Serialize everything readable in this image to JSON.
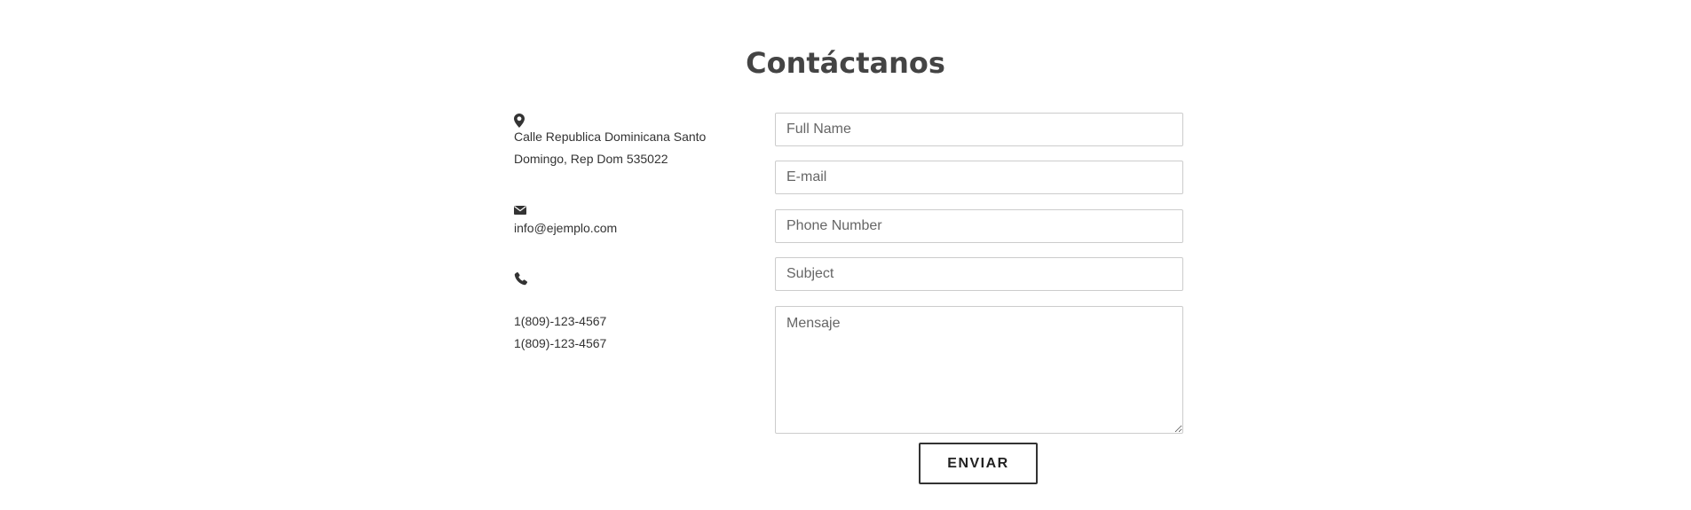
{
  "page": {
    "title": "Contáctanos"
  },
  "contact_info": {
    "address": {
      "icon": "map-marker-icon",
      "line1": "Calle Republica Dominicana Santo",
      "line2": "Domingo, Rep Dom 535022"
    },
    "email": {
      "icon": "envelope-icon",
      "value": "info@ejemplo.com"
    },
    "phone": {
      "icon": "phone-icon",
      "numbers": [
        "1(809)-123-4567",
        "1(809)-123-4567"
      ]
    }
  },
  "form": {
    "full_name": {
      "value": "",
      "placeholder": "Full Name"
    },
    "email": {
      "value": "",
      "placeholder": "E-mail"
    },
    "phone": {
      "value": "",
      "placeholder": "Phone Number"
    },
    "subject": {
      "value": "",
      "placeholder": "Subject"
    },
    "message": {
      "value": "",
      "placeholder": "Mensaje"
    },
    "submit_label": "ENVIAR"
  },
  "colors": {
    "text": "#333333",
    "heading": "#444444",
    "field_border": "#cccccc",
    "button_border": "#333333",
    "background": "#ffffff"
  }
}
